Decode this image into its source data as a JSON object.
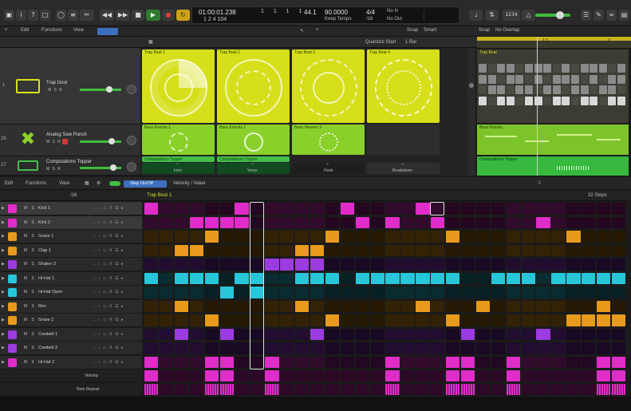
{
  "transport": {
    "position_time": "01:00:01.238",
    "position_bars": "1 1 1 1",
    "position_sub": "1 2 4 104",
    "tempo": "44.1",
    "tempo_value": "90.0000",
    "tempo_mode": "Keep Tempo",
    "signature": "4/4",
    "division": "/16",
    "in_label": "No In",
    "out_label": "No Out",
    "cpu_label": "1234"
  },
  "tracks_bar": {
    "edit": "Edit",
    "functions": "Functions",
    "view": "View",
    "snap_label": "Snap",
    "snap_value": "Smart",
    "quantize_label": "Quantize Start",
    "quantize_value": "1 Bar",
    "snap2_label": "Snap",
    "snap2_value": "No Overlap"
  },
  "tracks": [
    {
      "number": "1",
      "name": "Trap Door",
      "ms": "M S R",
      "color": "#d9e21a"
    },
    {
      "number": "26",
      "name": "Analog Saw Punch",
      "ms": "M S R",
      "color": "#8cd22a"
    },
    {
      "number": "27",
      "name": "Computations Topper",
      "ms": "M S R",
      "color": "#45c04a"
    }
  ],
  "live_cells": {
    "row1": [
      "Trap Beat 1",
      "Trap Beat 2",
      "Trap Beat 3",
      "Trap Beat 4"
    ],
    "row2": [
      "Bass Knocks 1",
      "Bass Knocks 2",
      "Bass Heaven 3"
    ],
    "row3": [
      "Computations Topper",
      "Computations Topper"
    ],
    "triggers": [
      "Intro",
      "Verse",
      "Hook",
      "Breakdown"
    ]
  },
  "timeline": {
    "region1": "Trap Beat",
    "region2": "Bass Knocks",
    "region3": "Computations Topper",
    "marker1": "1.5",
    "marker2": "2"
  },
  "step_bar": {
    "edit": "Edit",
    "functions": "Functions",
    "view": "View",
    "mode": "Step On/Off",
    "velocity": "Velocity / Value",
    "division": "/16",
    "steps": "32 Steps",
    "pattern": "Trap Beat 1"
  },
  "step_rows": [
    {
      "name": "Kick 1",
      "color": "#e02cc9",
      "steps": [
        1,
        0,
        0,
        0,
        0,
        0,
        1,
        0,
        0,
        0,
        0,
        0,
        0,
        1,
        0,
        0,
        0,
        0,
        1,
        0,
        0,
        0,
        0,
        0,
        0,
        0,
        0,
        0,
        0,
        0,
        0,
        0
      ]
    },
    {
      "name": "Kick 2",
      "color": "#e02cc9",
      "steps": [
        0,
        0,
        0,
        1,
        1,
        1,
        1,
        0,
        0,
        0,
        0,
        0,
        0,
        0,
        1,
        0,
        1,
        0,
        0,
        1,
        0,
        0,
        0,
        0,
        0,
        0,
        1,
        0,
        0,
        0,
        0,
        0
      ]
    },
    {
      "name": "Snare 1",
      "color": "#e89a1c",
      "steps": [
        0,
        0,
        0,
        0,
        1,
        0,
        0,
        0,
        0,
        0,
        0,
        0,
        1,
        0,
        0,
        0,
        0,
        0,
        0,
        0,
        1,
        0,
        0,
        0,
        0,
        0,
        0,
        0,
        1,
        0,
        0,
        0
      ]
    },
    {
      "name": "Clap 1",
      "color": "#e89a1c",
      "steps": [
        0,
        0,
        1,
        1,
        0,
        0,
        0,
        0,
        0,
        0,
        1,
        1,
        0,
        0,
        0,
        0,
        0,
        0,
        0,
        0,
        0,
        0,
        0,
        0,
        0,
        0,
        0,
        0,
        0,
        0,
        0,
        0
      ]
    },
    {
      "name": "Shaker 2",
      "color": "#9b3be0",
      "steps": [
        0,
        0,
        0,
        0,
        0,
        0,
        0,
        0,
        1,
        1,
        1,
        1,
        0,
        0,
        0,
        0,
        0,
        0,
        0,
        0,
        0,
        0,
        0,
        0,
        0,
        0,
        0,
        0,
        0,
        0,
        0,
        0
      ]
    },
    {
      "name": "Hi-Hat 1",
      "color": "#27c6d9",
      "steps": [
        1,
        0,
        1,
        1,
        1,
        0,
        1,
        1,
        0,
        0,
        1,
        1,
        1,
        0,
        1,
        1,
        1,
        1,
        1,
        1,
        1,
        0,
        0,
        1,
        1,
        1,
        0,
        1,
        1,
        1,
        1,
        1
      ]
    },
    {
      "name": "Hi-Hat Open",
      "color": "#27c6d9",
      "steps": [
        0,
        0,
        0,
        0,
        0,
        1,
        0,
        1,
        0,
        0,
        0,
        0,
        0,
        0,
        0,
        0,
        0,
        0,
        0,
        0,
        0,
        0,
        0,
        0,
        0,
        0,
        0,
        0,
        0,
        0,
        0,
        0
      ]
    },
    {
      "name": "Rim",
      "color": "#e89a1c",
      "steps": [
        0,
        0,
        1,
        0,
        0,
        0,
        0,
        0,
        0,
        0,
        1,
        0,
        0,
        0,
        0,
        0,
        0,
        0,
        1,
        0,
        0,
        0,
        1,
        0,
        0,
        0,
        0,
        0,
        0,
        0,
        1,
        0
      ]
    },
    {
      "name": "Snare 2",
      "color": "#e89a1c",
      "steps": [
        0,
        0,
        0,
        0,
        1,
        0,
        0,
        0,
        0,
        0,
        0,
        0,
        1,
        0,
        0,
        0,
        0,
        0,
        0,
        0,
        1,
        0,
        0,
        0,
        0,
        0,
        0,
        0,
        1,
        1,
        1,
        1
      ]
    },
    {
      "name": "Cowbell 1",
      "color": "#9b3be0",
      "steps": [
        0,
        0,
        1,
        0,
        0,
        1,
        0,
        0,
        0,
        0,
        0,
        1,
        0,
        0,
        0,
        0,
        0,
        0,
        0,
        0,
        0,
        1,
        0,
        0,
        0,
        0,
        1,
        0,
        0,
        0,
        0,
        0
      ]
    },
    {
      "name": "Cowbell 2",
      "color": "#9b3be0",
      "steps": [
        0,
        0,
        0,
        0,
        0,
        0,
        0,
        0,
        0,
        0,
        0,
        0,
        0,
        0,
        0,
        0,
        0,
        0,
        0,
        0,
        0,
        0,
        0,
        0,
        0,
        0,
        0,
        0,
        0,
        0,
        0,
        0
      ]
    },
    {
      "name": "Hi-Hat 2",
      "color": "#e02cc9",
      "steps": [
        1,
        0,
        0,
        0,
        1,
        1,
        0,
        0,
        1,
        0,
        0,
        0,
        0,
        0,
        0,
        0,
        1,
        0,
        0,
        0,
        1,
        1,
        0,
        0,
        1,
        0,
        0,
        0,
        0,
        0,
        1,
        1
      ]
    }
  ],
  "sub_rows": {
    "velocity": "Velocity",
    "note_repeat": "Note Repeat"
  },
  "colors": {
    "lime": "#d9e21a",
    "green": "#8cd22a",
    "dark_green": "#45c04a",
    "magenta": "#e02cc9",
    "orange": "#e89a1c",
    "purple": "#9b3be0",
    "cyan": "#27c6d9"
  }
}
